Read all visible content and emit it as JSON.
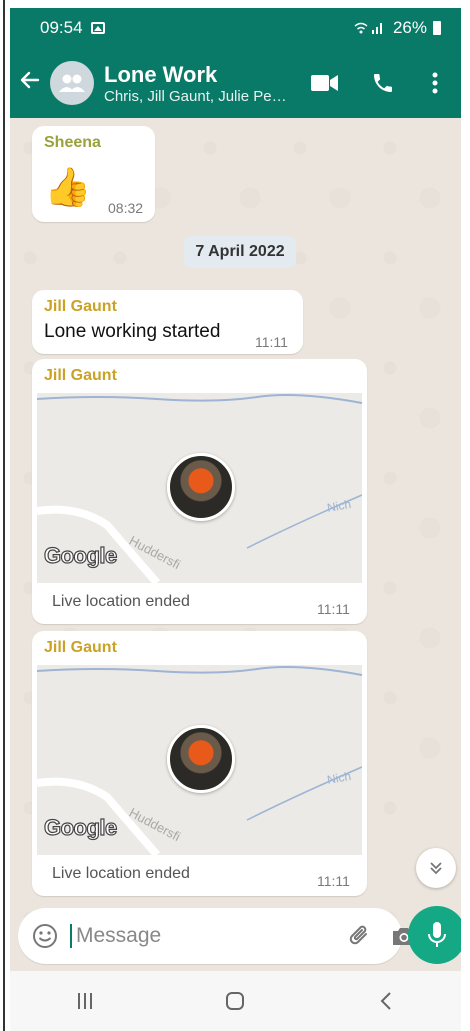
{
  "status_bar": {
    "time": "09:54",
    "battery": "26%"
  },
  "header": {
    "title": "Lone Work",
    "subtitle": "Chris, Jill Gaunt, Julie Pe…"
  },
  "messages": {
    "m1": {
      "sender": "Sheena",
      "time": "08:32",
      "emoji": "👍"
    },
    "date_chip": "7 April 2022",
    "m2": {
      "sender": "Jill Gaunt",
      "text": "Lone working started",
      "time": "11:11"
    },
    "m3": {
      "sender": "Jill Gaunt",
      "status": "Live location ended",
      "time": "11:11",
      "map_label_1": "Huddersfi",
      "map_label_2": "Nich"
    },
    "m4": {
      "sender": "Jill Gaunt",
      "status": "Live location ended",
      "time": "11:11",
      "map_label_1": "Huddersfi",
      "map_label_2": "Nich"
    },
    "google_logo": "Google"
  },
  "composer": {
    "placeholder": "Message"
  },
  "colors": {
    "brand": "#0a7a68",
    "accent": "#14a884",
    "sender": "#c9a227"
  },
  "icons": [
    "back-arrow-icon",
    "group-icon",
    "video-call-icon",
    "phone-icon",
    "more-options-icon",
    "emoji-icon",
    "attach-icon",
    "camera-icon",
    "mic-icon",
    "scroll-down-icon",
    "recents-icon",
    "home-icon",
    "nav-back-icon"
  ]
}
